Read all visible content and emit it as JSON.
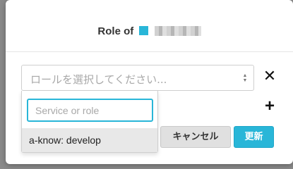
{
  "modal": {
    "title_prefix": "Role of",
    "accent_color": "#29b6d8"
  },
  "role_select": {
    "placeholder": "ロールを選択してください...",
    "remove_icon": "close-icon",
    "add_icon": "plus-icon"
  },
  "dropdown": {
    "search_placeholder": "Service or role",
    "search_value": "",
    "options": [
      {
        "label": "a-know: develop"
      }
    ]
  },
  "footer": {
    "cancel_label": "キャンセル",
    "update_label": "更新"
  }
}
